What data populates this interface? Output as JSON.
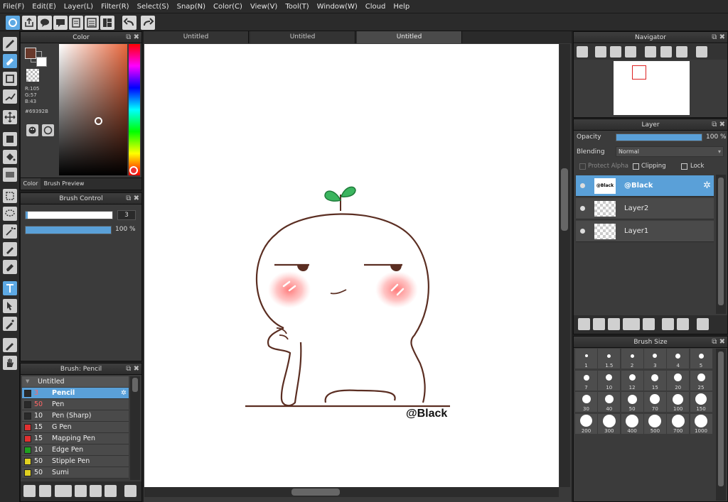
{
  "menu": [
    "File(F)",
    "Edit(E)",
    "Layer(L)",
    "Filter(R)",
    "Select(S)",
    "Snap(N)",
    "Color(C)",
    "View(V)",
    "Tool(T)",
    "Window(W)",
    "Cloud",
    "Help"
  ],
  "tabs": [
    "Untitled",
    "Untitled",
    "Untitled"
  ],
  "color_panel": {
    "title": "Color",
    "r": "R:105",
    "g": "G:57",
    "b": "B:43",
    "hex": "#69392B",
    "tab_color": "Color",
    "tab_preview": "Brush Preview",
    "fg_color": "#69392b"
  },
  "brush_control": {
    "title": "Brush Control",
    "size_value": "3",
    "opacity_value": "100 %",
    "opacity_fraction": 1.0
  },
  "brush_list": {
    "title": "Brush: Pencil",
    "group": "Untitled",
    "items": [
      {
        "num": "3",
        "name": "Pencil",
        "color": "#2a2a2a"
      },
      {
        "num": "50",
        "name": "Pen",
        "color": "#2a2a2a"
      },
      {
        "num": "10",
        "name": "Pen (Sharp)",
        "color": "#2a2a2a"
      },
      {
        "num": "15",
        "name": "G Pen",
        "color": "#e03030"
      },
      {
        "num": "15",
        "name": "Mapping Pen",
        "color": "#e03030"
      },
      {
        "num": "10",
        "name": "Edge Pen",
        "color": "#20a020"
      },
      {
        "num": "50",
        "name": "Stipple Pen",
        "color": "#e0d020"
      },
      {
        "num": "50",
        "name": "Sumi",
        "color": "#e0d020"
      }
    ]
  },
  "navigator": {
    "title": "Navigator"
  },
  "layer_panel": {
    "title": "Layer",
    "opacity_label": "Opacity",
    "opacity_value": "100 %",
    "blending_label": "Blending",
    "blending_value": "Normal",
    "protect_alpha": "Protect Alpha",
    "clipping": "Clipping",
    "lock": "Lock",
    "layers": [
      {
        "name": "@Black",
        "thumb": "@Black"
      },
      {
        "name": "Layer2"
      },
      {
        "name": "Layer1"
      }
    ]
  },
  "brush_size": {
    "title": "Brush Size",
    "sizes": [
      "1",
      "1.5",
      "2",
      "3",
      "4",
      "5",
      "7",
      "10",
      "12",
      "15",
      "20",
      "25",
      "30",
      "40",
      "50",
      "70",
      "100",
      "150",
      "200",
      "300",
      "400",
      "500",
      "700",
      "1000"
    ]
  },
  "artwork": {
    "signature": "@Black"
  }
}
